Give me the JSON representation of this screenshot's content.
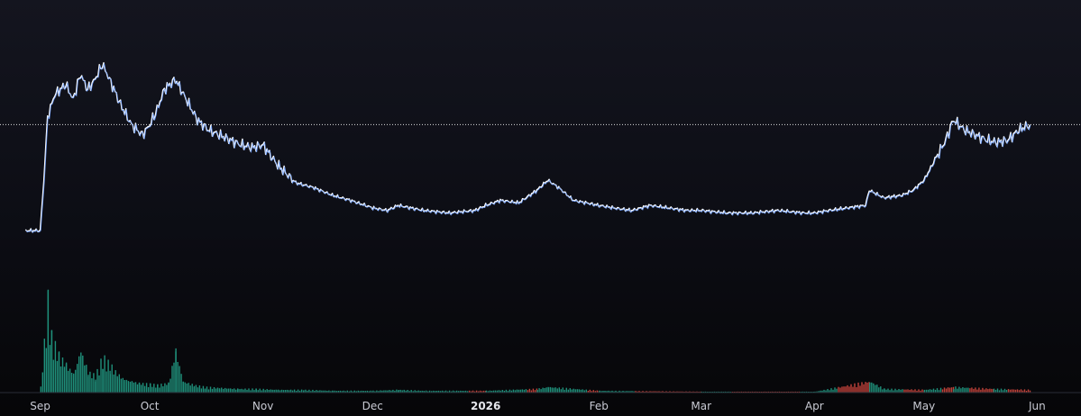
{
  "chart_data": {
    "type": "line",
    "title": "",
    "xlabel": "",
    "ylabel": "",
    "x_ticks": [
      {
        "label": "Sep",
        "date": "2025-09-01",
        "bold": false
      },
      {
        "label": "Oct",
        "date": "2025-10-01",
        "bold": false
      },
      {
        "label": "Nov",
        "date": "2025-11-01",
        "bold": false
      },
      {
        "label": "Dec",
        "date": "2025-12-01",
        "bold": false
      },
      {
        "label": "2026",
        "date": "2026-01-01",
        "bold": true
      },
      {
        "label": "Feb",
        "date": "2026-02-01",
        "bold": false
      },
      {
        "label": "Mar",
        "date": "2026-03-01",
        "bold": false
      },
      {
        "label": "Apr",
        "date": "2026-04-01",
        "bold": false
      },
      {
        "label": "May",
        "date": "2026-05-01",
        "bold": false
      },
      {
        "label": "Jun",
        "date": "2026-06-01",
        "bold": false
      }
    ],
    "xlim": [
      "2025-08-21",
      "2026-06-13"
    ],
    "ylim": [
      0,
      100
    ],
    "grid": false,
    "last_price_line": 72,
    "series": [
      {
        "kind": "price",
        "color": "#ffffff",
        "accent": "#6fa0ff",
        "points": [
          [
            "2025-08-28",
            30
          ],
          [
            "2025-09-01",
            30
          ],
          [
            "2025-09-02",
            50
          ],
          [
            "2025-09-03",
            75
          ],
          [
            "2025-09-05",
            84
          ],
          [
            "2025-09-08",
            88
          ],
          [
            "2025-09-10",
            82
          ],
          [
            "2025-09-12",
            92
          ],
          [
            "2025-09-14",
            86
          ],
          [
            "2025-09-16",
            90
          ],
          [
            "2025-09-18",
            96
          ],
          [
            "2025-09-20",
            90
          ],
          [
            "2025-09-23",
            80
          ],
          [
            "2025-09-26",
            72
          ],
          [
            "2025-09-29",
            68
          ],
          [
            "2025-10-01",
            72
          ],
          [
            "2025-10-03",
            78
          ],
          [
            "2025-10-05",
            86
          ],
          [
            "2025-10-08",
            90
          ],
          [
            "2025-10-11",
            82
          ],
          [
            "2025-10-14",
            74
          ],
          [
            "2025-10-17",
            70
          ],
          [
            "2025-10-20",
            68
          ],
          [
            "2025-10-23",
            66
          ],
          [
            "2025-10-26",
            64
          ],
          [
            "2025-10-29",
            63
          ],
          [
            "2025-11-01",
            64
          ],
          [
            "2025-11-05",
            56
          ],
          [
            "2025-11-10",
            49
          ],
          [
            "2025-11-15",
            47
          ],
          [
            "2025-11-20",
            44
          ],
          [
            "2025-11-25",
            42
          ],
          [
            "2025-12-01",
            39
          ],
          [
            "2025-12-05",
            38
          ],
          [
            "2025-12-08",
            40
          ],
          [
            "2025-12-15",
            38
          ],
          [
            "2025-12-22",
            37
          ],
          [
            "2025-12-29",
            38
          ],
          [
            "2026-01-01",
            40
          ],
          [
            "2026-01-05",
            42
          ],
          [
            "2026-01-10",
            41
          ],
          [
            "2026-01-15",
            46
          ],
          [
            "2026-01-18",
            50
          ],
          [
            "2026-01-21",
            47
          ],
          [
            "2026-01-25",
            42
          ],
          [
            "2026-02-01",
            40
          ],
          [
            "2026-02-05",
            39
          ],
          [
            "2026-02-10",
            38
          ],
          [
            "2026-02-15",
            40
          ],
          [
            "2026-02-20",
            39
          ],
          [
            "2026-02-25",
            38
          ],
          [
            "2026-03-01",
            38
          ],
          [
            "2026-03-08",
            37
          ],
          [
            "2026-03-15",
            37
          ],
          [
            "2026-03-22",
            38
          ],
          [
            "2026-03-29",
            37
          ],
          [
            "2026-04-01",
            37
          ],
          [
            "2026-04-05",
            38
          ],
          [
            "2026-04-10",
            39
          ],
          [
            "2026-04-15",
            40
          ],
          [
            "2026-04-16",
            46
          ],
          [
            "2026-04-20",
            43
          ],
          [
            "2026-04-25",
            44
          ],
          [
            "2026-04-28",
            46
          ],
          [
            "2026-05-01",
            50
          ],
          [
            "2026-05-04",
            58
          ],
          [
            "2026-05-07",
            66
          ],
          [
            "2026-05-09",
            74
          ],
          [
            "2026-05-12",
            70
          ],
          [
            "2026-05-15",
            68
          ],
          [
            "2026-05-18",
            66
          ],
          [
            "2026-05-21",
            65
          ],
          [
            "2026-05-24",
            66
          ],
          [
            "2026-05-27",
            70
          ],
          [
            "2026-05-30",
            72
          ]
        ]
      },
      {
        "kind": "volume",
        "up_color": "#1f8f7a",
        "down_color": "#c2433a",
        "points": [
          [
            "2025-09-01",
            6
          ],
          [
            "2025-09-03",
            100
          ],
          [
            "2025-09-04",
            60
          ],
          [
            "2025-09-06",
            40
          ],
          [
            "2025-09-08",
            30
          ],
          [
            "2025-09-10",
            20
          ],
          [
            "2025-09-12",
            45
          ],
          [
            "2025-09-14",
            22
          ],
          [
            "2025-09-16",
            18
          ],
          [
            "2025-09-18",
            38
          ],
          [
            "2025-09-20",
            30
          ],
          [
            "2025-09-22",
            20
          ],
          [
            "2025-09-24",
            14
          ],
          [
            "2025-09-26",
            12
          ],
          [
            "2025-09-28",
            10
          ],
          [
            "2025-10-01",
            9
          ],
          [
            "2025-10-03",
            8
          ],
          [
            "2025-10-06",
            10
          ],
          [
            "2025-10-08",
            45
          ],
          [
            "2025-10-10",
            12
          ],
          [
            "2025-10-13",
            8
          ],
          [
            "2025-10-16",
            6
          ],
          [
            "2025-10-20",
            5
          ],
          [
            "2025-10-25",
            4
          ],
          [
            "2025-10-30",
            4
          ],
          [
            "2025-11-05",
            3
          ],
          [
            "2025-11-12",
            3
          ],
          [
            "2025-11-20",
            2
          ],
          [
            "2025-12-01",
            2
          ],
          [
            "2025-12-08",
            3
          ],
          [
            "2025-12-15",
            2
          ],
          [
            "2026-01-01",
            2
          ],
          [
            "2026-01-15",
            4
          ],
          [
            "2026-01-18",
            6
          ],
          [
            "2026-02-01",
            2
          ],
          [
            "2026-03-01",
            1
          ],
          [
            "2026-04-01",
            1
          ],
          [
            "2026-04-16",
            12
          ],
          [
            "2026-04-20",
            4
          ],
          [
            "2026-05-01",
            3
          ],
          [
            "2026-05-09",
            6
          ],
          [
            "2026-05-20",
            4
          ],
          [
            "2026-05-30",
            3
          ]
        ]
      }
    ]
  }
}
